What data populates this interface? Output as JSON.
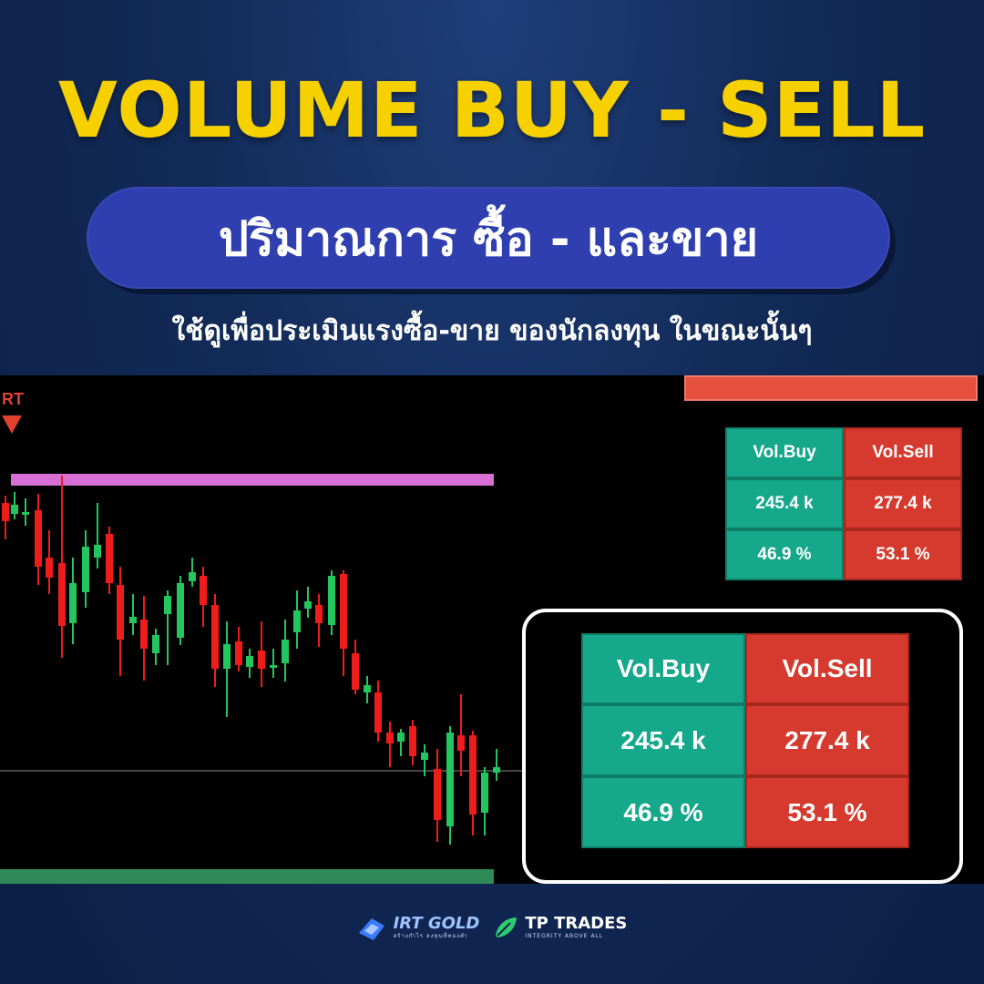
{
  "headline": "VOLUME BUY - SELL",
  "pill_text": "ปริมาณการ ซื้อ - และขาย",
  "subline": "ใช้ดูเพื่อประเมินแรงซื้อ-ขาย ของนักลงทุน ในขณะนั้นๆ",
  "chart_marker_label": "RT",
  "volume_table": {
    "buy_header": "Vol.Buy",
    "sell_header": "Vol.Sell",
    "buy_volume": "245.4 k",
    "sell_volume": "277.4 k",
    "buy_percent": "46.9 %",
    "sell_percent": "53.1 %"
  },
  "footer": {
    "brand1_name": "IRT GOLD",
    "brand1_tag": "สร้างกำไร ลงทุนที่ทองคำ",
    "brand2_name": "TP TRADES",
    "brand2_tag": "INTEGRITY ABOVE ALL"
  },
  "colors": {
    "headline": "#f7d000",
    "pill": "#2f3fb0",
    "buy": "#16a88a",
    "sell": "#d63a2e",
    "bull_candle": "#22c55e",
    "bear_candle": "#ef1c1c"
  }
}
